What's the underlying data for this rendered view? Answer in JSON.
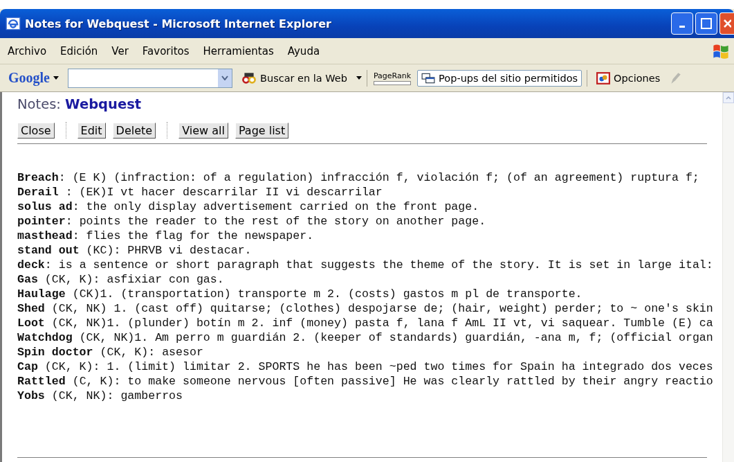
{
  "window": {
    "title": "Notes for Webquest - Microsoft Internet Explorer"
  },
  "menu": [
    "Archivo",
    "Edición",
    "Ver",
    "Favoritos",
    "Herramientas",
    "Ayuda"
  ],
  "toolbar": {
    "brand": "Google",
    "search_button": "Buscar en la Web",
    "pagerank": {
      "label": "PageRank"
    },
    "popups": "Pop-ups del sitio permitidos",
    "options": "Opciones"
  },
  "page": {
    "heading_prefix": "Notes:",
    "heading_title": "Webquest",
    "button_groups": [
      [
        "Close"
      ],
      [
        "Edit",
        "Delete"
      ],
      [
        "View all",
        "Page list"
      ]
    ],
    "notes": [
      {
        "term": "Breach",
        "text": ": (E K) (infraction: of a regulation) infracción f, violación f; (of an agreement) ruptura f;"
      },
      {
        "term": "Derail",
        "text": " : (EK)I vt hacer descarrilar II vi descarrilar"
      },
      {
        "term": "solus ad",
        "text": ": the only display advertisement carried on the front page."
      },
      {
        "term": "pointer",
        "text": ": points the reader to the rest of the story on another page."
      },
      {
        "term": "masthead",
        "text": ": flies the flag for the newspaper."
      },
      {
        "term": "stand out",
        "text": " (KC): PHRVB vi destacar."
      },
      {
        "term": "deck",
        "text": ": is a sentence or short paragraph that suggests the theme of the story. It is set in large ital:"
      },
      {
        "term": "Gas",
        "text": " (CK, K): asfixiar con gas."
      },
      {
        "term": "Haulage",
        "text": " (CK)1. (transportation) transporte m 2. (costs) gastos m pl de transporte."
      },
      {
        "term": "Shed",
        "text": " (CK, NK) 1. (cast off) quitarse; (clothes) despojarse de; (hair, weight) perder; to ~ one's skin"
      },
      {
        "term": "Loot",
        "text": " (CK, NK)1. (plunder) botín m 2. inf (money) pasta f, lana f AmL II vt, vi saquear. Tumble (E) ca"
      },
      {
        "term": "Watchdog",
        "text": " (CK, NK)1. Am perro m guardián 2. (keeper of standards) guardián, -ana m, f; (official organ"
      },
      {
        "term": "Spin doctor",
        "text": " (CK, K): asesor"
      },
      {
        "term": "Cap",
        "text": " (CK, K): 1. (limit) limitar 2. SPORTS he has been ~ped two times for Spain ha integrado dos veces"
      },
      {
        "term": "Rattled",
        "text": " (C, K): to make someone nervous [often passive] He was clearly rattled by their angry reactio"
      },
      {
        "term": "Yobs",
        "text": " (CK, NK): gamberros"
      }
    ]
  }
}
